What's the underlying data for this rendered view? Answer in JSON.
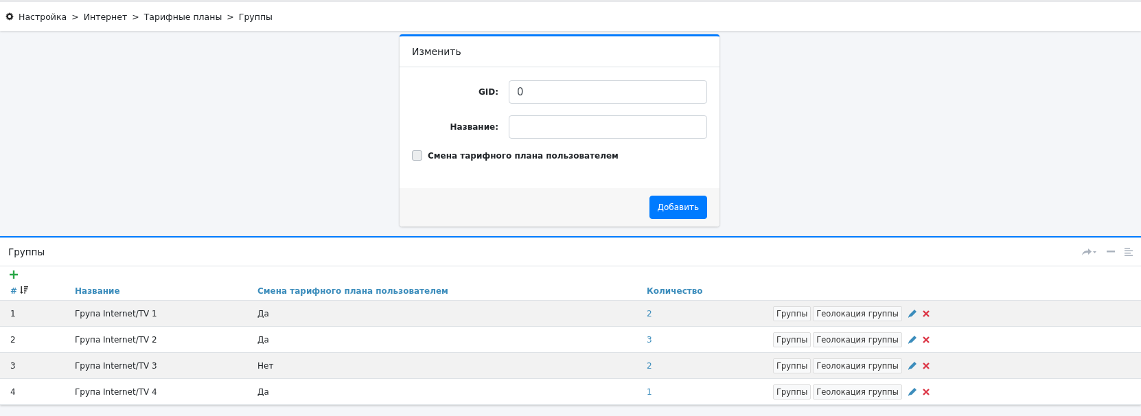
{
  "breadcrumb": {
    "items": [
      "Настройка",
      "Интернет",
      "Тарифные планы",
      "Группы"
    ],
    "separators": [
      ">",
      ">",
      ">"
    ]
  },
  "form": {
    "title": "Изменить",
    "fields": [
      {
        "label": "GID:",
        "value": "0"
      },
      {
        "label": "Название:"
      }
    ],
    "checkbox": {
      "label": "Смена тарифного плана пользователем",
      "checked": false
    },
    "submit": "Добавить"
  },
  "groups": {
    "title": "Группы",
    "columns": [
      "#",
      "Название",
      "Смена тарифного плана пользователем",
      "Количество"
    ],
    "rows": [
      {
        "id": "1",
        "name": "Група Internet/TV 1",
        "change": "Да",
        "count": "2",
        "actions": [
          "Группы",
          "Геолокация группы"
        ]
      },
      {
        "id": "2",
        "name": "Група Internet/TV 2",
        "change": "Да",
        "count": "3",
        "actions": [
          "Группы",
          "Геолокация группы"
        ]
      },
      {
        "id": "3",
        "name": "Група Internet/TV 3",
        "change": "Нет",
        "count": "2",
        "actions": [
          "Группы",
          "Геолокация группы"
        ]
      },
      {
        "id": "4",
        "name": "Група Internet/TV 4",
        "change": "Да",
        "count": "1",
        "actions": [
          "Группы",
          "Геолокация группы"
        ]
      }
    ]
  }
}
